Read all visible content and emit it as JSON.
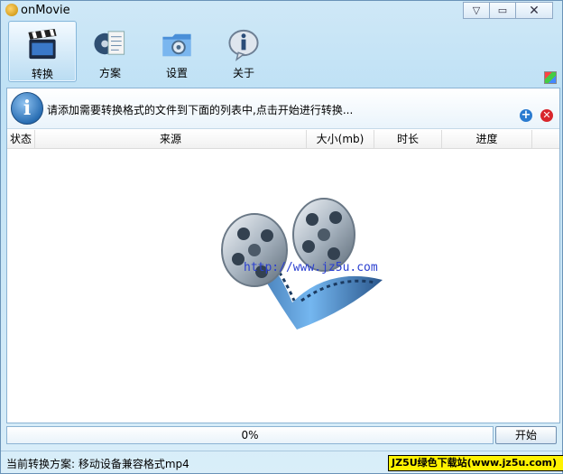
{
  "window": {
    "title": "onMovie"
  },
  "toolbar": {
    "items": [
      {
        "label": "转换",
        "icon": "clapperboard-icon",
        "active": true
      },
      {
        "label": "方案",
        "icon": "scheme-icon",
        "active": false
      },
      {
        "label": "设置",
        "icon": "settings-folder-icon",
        "active": false
      },
      {
        "label": "关于",
        "icon": "about-info-icon",
        "active": false
      }
    ]
  },
  "info": {
    "message": "请添加需要转换格式的文件到下面的列表中,点击开始进行转换..."
  },
  "table": {
    "columns": [
      "状态",
      "来源",
      "大小(mb)",
      "时长",
      "进度"
    ]
  },
  "watermark": "http://www.jz5u.com",
  "progress": {
    "text": "0%",
    "value": 0
  },
  "buttons": {
    "start": "开始"
  },
  "status": {
    "text": "当前转换方案: 移动设备兼容格式mp4",
    "badge": "JZ5U绿色下载站(www.jz5u.com)"
  },
  "colors": {
    "accent": "#2a6fb4",
    "badge_bg": "#fff200"
  }
}
